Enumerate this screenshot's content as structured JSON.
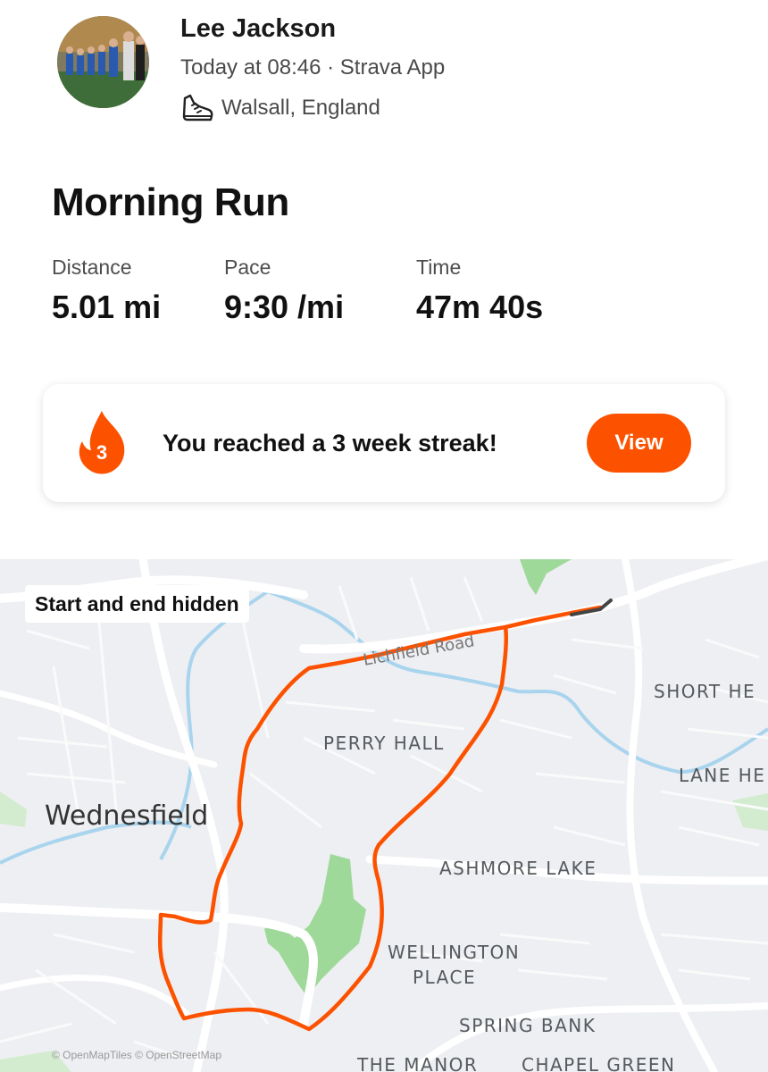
{
  "athlete": {
    "name": "Lee Jackson",
    "meta": "Today at 08:46 · Strava App",
    "location": "Walsall, England"
  },
  "activity": {
    "title": "Morning Run",
    "stats": [
      {
        "label": "Distance",
        "value": "5.01 mi"
      },
      {
        "label": "Pace",
        "value": "9:30 /mi"
      },
      {
        "label": "Time",
        "value": "47m 40s"
      }
    ]
  },
  "streak": {
    "count": "3",
    "message": "You reached a 3 week streak!",
    "button_label": "View"
  },
  "map": {
    "badge": "Start and end hidden",
    "road_label": "Lichfield Road",
    "places": {
      "wednesfield": "Wednesfield",
      "perry_hall": "PERRY HALL",
      "short_heath": "SHORT HE",
      "lane_head": "LANE HE",
      "ashmore_lake": "ASHMORE LAKE",
      "wellington_place_1": "WELLINGTON",
      "wellington_place_2": "PLACE",
      "spring_bank": "SPRING BANK",
      "the_manor": "THE MANOR",
      "chapel_green": "CHAPEL GREEN"
    },
    "attribution": "© OpenMapTiles © OpenStreetMap",
    "route_color": "#fc5200",
    "water_color": "#a8d4ee",
    "park_color": "#9fd99a"
  },
  "colors": {
    "brand": "#fc5200"
  },
  "icons": {
    "location": "running-shoe-icon",
    "streak": "flame-icon"
  }
}
